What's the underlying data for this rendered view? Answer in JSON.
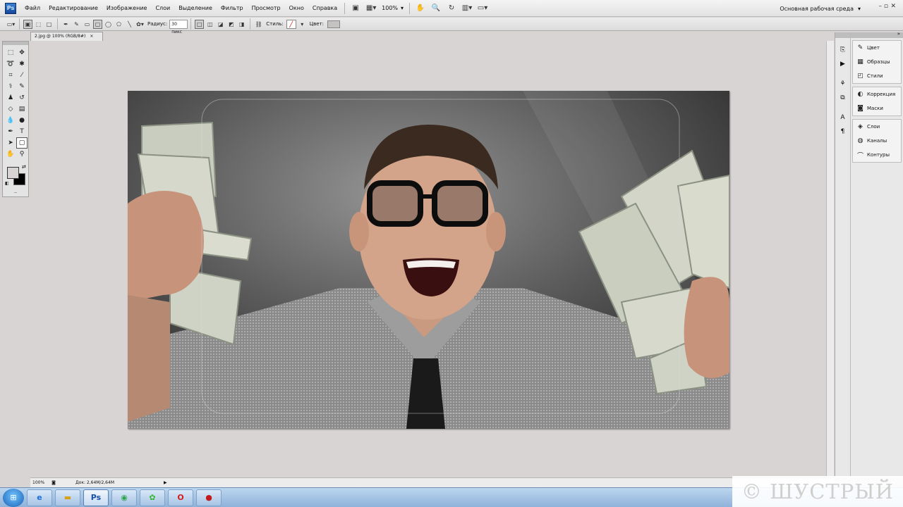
{
  "menubar": {
    "logo": "Ps",
    "items": [
      "Файл",
      "Редактирование",
      "Изображение",
      "Слои",
      "Выделение",
      "Фильтр",
      "Просмотр",
      "Окно",
      "Справка"
    ],
    "zoom": "100%",
    "workspace": "Основная рабочая среда"
  },
  "options": {
    "radius_label": "Радиус:",
    "radius_value": "30 пикс",
    "styles_label": "Стиль:",
    "color_label": "Цвет:",
    "color_value": "#c5c2c2"
  },
  "document": {
    "tab_title": "2.jpg @ 100% (RGB/8#)",
    "tab_close": "×"
  },
  "statusbar": {
    "zoom": "100%",
    "doc_info": "Док: 2,64M/2,64M"
  },
  "panels": {
    "group1": [
      "Цвет",
      "Образцы",
      "Стили"
    ],
    "group2": [
      "Коррекция",
      "Маски"
    ],
    "group3": [
      "Слои",
      "Каналы",
      "Контуры"
    ]
  },
  "tools": {
    "foreground_color": "#d8d4d4",
    "background_color": "#000000"
  },
  "taskbar": {
    "items": [
      "windows-start",
      "internet-explorer",
      "file-explorer",
      "photoshop",
      "chrome",
      "icq",
      "opera",
      "video-recorder"
    ],
    "active": "photoshop"
  },
  "watermark": "© ШУСТРЫЙ"
}
